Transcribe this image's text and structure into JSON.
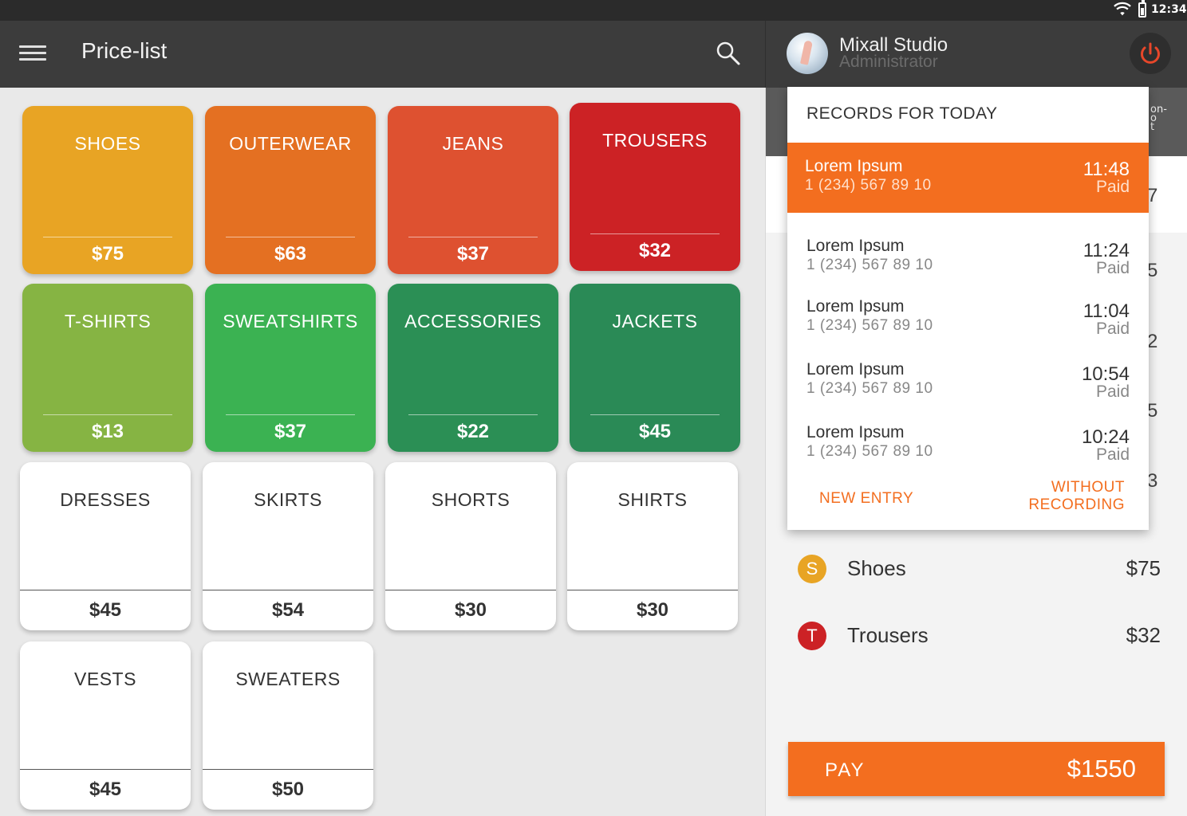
{
  "status_bar": {
    "time": "12:34"
  },
  "header": {
    "title": "Price-list"
  },
  "user": {
    "name": "Mixall Studio",
    "role": "Administrator"
  },
  "categories": [
    {
      "name": "SHOES",
      "price": "$75",
      "color": "#e8a424"
    },
    {
      "name": "OUTERWEAR",
      "price": "$63",
      "color": "#e47022"
    },
    {
      "name": "JEANS",
      "price": "$37",
      "color": "#de5130"
    },
    {
      "name": "TROUSERS",
      "price": "$32",
      "color": "#cc2225"
    },
    {
      "name": "T-SHIRTS",
      "price": "$13",
      "color": "#86b443"
    },
    {
      "name": "SWEATSHIRTS",
      "price": "$37",
      "color": "#3bb252"
    },
    {
      "name": "ACCESSORIES",
      "price": "$22",
      "color": "#2b8f55"
    },
    {
      "name": "JACKETS",
      "price": "$45",
      "color": "#2a8a56"
    },
    {
      "name": "DRESSES",
      "price": "$45"
    },
    {
      "name": "SKIRTS",
      "price": "$54"
    },
    {
      "name": "SHORTS",
      "price": "$30"
    },
    {
      "name": "SHIRTS",
      "price": "$30"
    },
    {
      "name": "VESTS",
      "price": "$45"
    },
    {
      "name": "SWEATERS",
      "price": "$50"
    }
  ],
  "records": {
    "title": "RECORDS FOR TODAY",
    "items": [
      {
        "name": "Lorem Ipsum",
        "phone": "1 (234) 567 89 10",
        "time": "11:48",
        "status": "Paid",
        "active": true
      },
      {
        "name": "Lorem Ipsum",
        "phone": "1 (234) 567 89 10",
        "time": "11:24",
        "status": "Paid"
      },
      {
        "name": "Lorem Ipsum",
        "phone": "1 (234) 567 89 10",
        "time": "11:04",
        "status": "Paid"
      },
      {
        "name": "Lorem Ipsum",
        "phone": "1 (234) 567 89 10",
        "time": "10:54",
        "status": "Paid"
      },
      {
        "name": "Lorem Ipsum",
        "phone": "1 (234) 567 89 10",
        "time": "10:24",
        "status": "Paid"
      }
    ],
    "new_entry_label": "NEW ENTRY",
    "without_recording_label": "WITHOUT RECORDING"
  },
  "right_panel": {
    "peek_tab_text": "on-\no\nt",
    "peek_values": [
      "7",
      "5",
      "2",
      "5",
      "3"
    ]
  },
  "order_items": [
    {
      "badge": "S",
      "name": "Shoes",
      "price": "$75",
      "color": "#e8a424"
    },
    {
      "badge": "T",
      "name": "Trousers",
      "price": "$32",
      "color": "#cc2225"
    }
  ],
  "pay": {
    "label": "PAY",
    "total": "$1550"
  },
  "colors": {
    "accent": "#f36e1f",
    "toolbar": "#3c3c3c"
  }
}
